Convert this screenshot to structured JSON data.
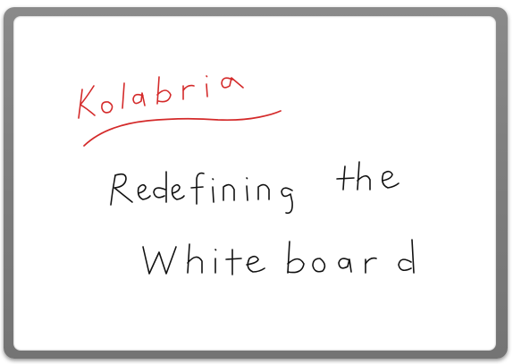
{
  "whiteboard": {
    "brand_text": "Kolabria",
    "tagline_line1": "Redefining the",
    "tagline_line2": "Whiteboard",
    "ink_colors": {
      "brand": "#d42a2a",
      "tagline": "#111111"
    },
    "frame_color": "#7f7f7f"
  }
}
